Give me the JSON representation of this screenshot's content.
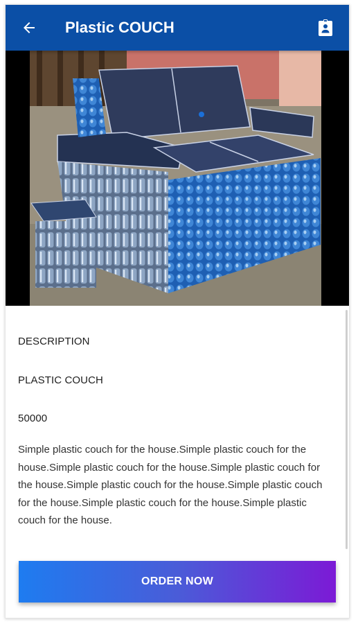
{
  "app_bar": {
    "title": "Plastic COUCH",
    "back_icon": "arrow-back-icon",
    "right_icon": "contact-badge-icon",
    "color": "#0b4fa6"
  },
  "product": {
    "description_heading": "DESCRIPTION",
    "name": "PLASTIC COUCH",
    "price": "50000",
    "description": "Simple plastic couch for the house.Simple plastic couch for the house.Simple plastic couch for the house.Simple plastic couch for the house.Simple plastic couch for the house.Simple plastic couch for the house.Simple plastic couch for the house.Simple plastic couch for the house."
  },
  "order_button": {
    "label": "ORDER NOW",
    "gradient": [
      "#1e7cf0",
      "#7c1ad6"
    ]
  }
}
